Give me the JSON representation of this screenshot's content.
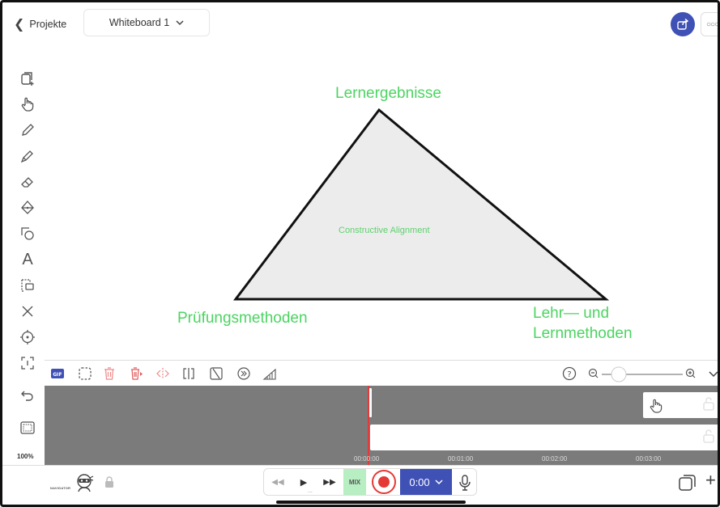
{
  "header": {
    "back_label": "Projekte",
    "board_title": "Whiteboard 1"
  },
  "canvas": {
    "labels": {
      "top": "Lernergebnisse",
      "bottom_left": "Prüfungsmethoden",
      "bottom_right_line1": "Lehr— und",
      "bottom_right_line2": "Lernmethoden",
      "center": "Constructive Alignment"
    },
    "label_color": "#4cd462"
  },
  "sidebar": {
    "zoom_percent": "100%",
    "tools": [
      "add-page-icon",
      "hand-icon",
      "pen-icon",
      "marker-icon",
      "eraser-icon",
      "fill-icon",
      "shapes-icon",
      "text-icon",
      "select-icon",
      "delete-icon",
      "laser-icon",
      "crop-icon",
      "undo-icon",
      "frame-icon"
    ]
  },
  "timeline": {
    "ticks": [
      "00:00:00",
      "00:01:00",
      "00:02:00",
      "00:03:00"
    ]
  },
  "bottom": {
    "navigator_label": "NAVIGATOR",
    "mix_label": "MIX",
    "time": "0:00",
    "ellipsis": "..."
  },
  "colors": {
    "accent": "#3f51b5",
    "record": "#e53935",
    "mix_bg": "#b7eec2",
    "timeline_bg": "#7b7b7b",
    "delete_red": "#e05a5a"
  }
}
